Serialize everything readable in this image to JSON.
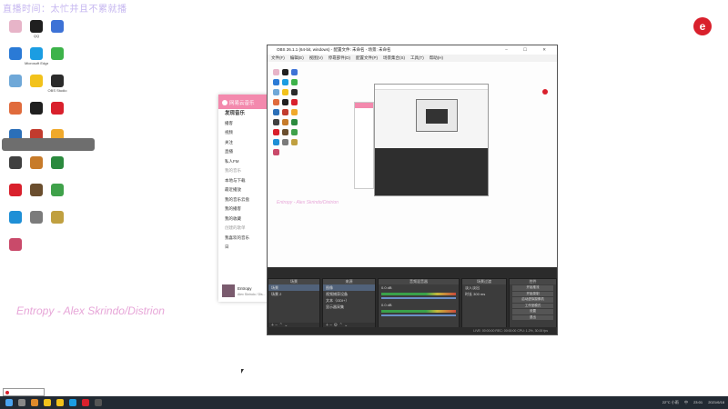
{
  "overlay": {
    "stream_title": "直播时间：太忙并且不累就播",
    "song": "Entropy - Alex Skrindo/Distrion",
    "colors": {
      "title": "#c6b7f0",
      "song": "#e7a6d8",
      "logo": "#d9202c"
    }
  },
  "desktop": {
    "icons": [
      {
        "label": "",
        "color": "#e7b4c8"
      },
      {
        "label": "QQ",
        "color": "#1f1f1f"
      },
      {
        "label": "",
        "color": "#3d72d6"
      },
      {
        "label": "",
        "color": "#2a7ad6"
      },
      {
        "label": "Microsoft Edge",
        "color": "#1b9de2"
      },
      {
        "label": "",
        "color": "#3db34a"
      },
      {
        "label": "",
        "color": "#6fa8d8"
      },
      {
        "label": "",
        "color": "#f2c21b"
      },
      {
        "label": "OBS Studio",
        "color": "#2b2b2b"
      },
      {
        "label": "",
        "color": "#e06b3c"
      },
      {
        "label": "",
        "color": "#1f1f1f"
      },
      {
        "label": "",
        "color": "#d9202c"
      },
      {
        "label": "",
        "color": "#2b6fb8"
      },
      {
        "label": "",
        "color": "#c23b2e"
      },
      {
        "label": "",
        "color": "#f0a92b"
      },
      {
        "label": "",
        "color": "#404040"
      },
      {
        "label": "",
        "color": "#c77b2a"
      },
      {
        "label": "",
        "color": "#2b8a3e"
      },
      {
        "label": "",
        "color": "#d9202c"
      },
      {
        "label": "",
        "color": "#6a4e2e"
      },
      {
        "label": "",
        "color": "#3fa14a"
      },
      {
        "label": "",
        "color": "#1e8fd6"
      },
      {
        "label": "",
        "color": "#7b7b7b"
      },
      {
        "label": "",
        "color": "#c0a040"
      },
      {
        "label": "",
        "color": "#c94a6a"
      }
    ],
    "toast": ""
  },
  "music_player": {
    "brand": "网易云音乐",
    "items": [
      "发现音乐",
      "播客",
      "视频",
      "关注",
      "直播",
      "私人FM",
      "我的音乐",
      "本地与下载",
      "最近播放",
      "我的音乐云盘",
      "我的播客",
      "我的收藏",
      "创建的歌单",
      "我喜欢的音乐",
      "日"
    ],
    "now_playing": {
      "title": "Entropy",
      "artist": "Alex Skrindo / Dis..."
    }
  },
  "obs": {
    "title": "OBS 26.1.1 (64-bit, windows) - 配置文件: 未命名 - 场景: 未命名",
    "menu": [
      "文件(F)",
      "编辑(E)",
      "视图(V)",
      "停靠部件(D)",
      "配置文件(P)",
      "场景集合(S)",
      "工具(T)",
      "帮助(H)"
    ],
    "preview_overlay": "Entropy - Alex Skrindo/Distrion",
    "scenes": {
      "header": "场景",
      "items": [
        "场景",
        "场景 2"
      ]
    },
    "sources": {
      "header": "来源",
      "items": [
        "图像",
        "视频捕获设备",
        "文本（GDI+）",
        "显示器采集"
      ]
    },
    "mixer": {
      "header": "音频混音器",
      "channels": [
        {
          "name": "",
          "level": "0.0 dB"
        },
        {
          "name": "",
          "level": "0.0 dB"
        }
      ]
    },
    "transitions": {
      "header": "场景过渡",
      "type": "淡入淡出",
      "duration_label": "时长",
      "duration": "300 ms"
    },
    "controls": {
      "header": "控件",
      "buttons": [
        "开始推流",
        "开始录制",
        "启动虚拟摄像机",
        "工作室模式",
        "设置",
        "退出"
      ]
    },
    "status": "LIVE: 00:00:00   REC: 00:00:00   CPU: 1.2%, 30.00 fps"
  },
  "taskbar": {
    "weather": "22°C 小雨",
    "time": "23:01",
    "date": "2021/6/18",
    "lang": "中"
  }
}
